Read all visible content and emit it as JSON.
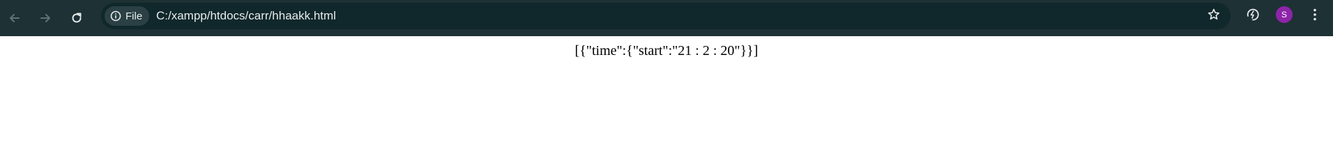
{
  "browser": {
    "back_icon": "arrow-left-icon",
    "forward_icon": "arrow-right-icon",
    "reload_icon": "reload-icon",
    "site_info_icon": "info-icon",
    "site_info_label": "File",
    "url": "C:/xampp/htdocs/carr/hhaakk.html",
    "bookmark_icon": "star-icon",
    "extension_icon": "performance-icon",
    "profile_initial": "S",
    "menu_icon": "kebab-menu-icon",
    "colors": {
      "toolbar_bg": "#1e3135",
      "omnibox_bg": "#10282b",
      "avatar_bg": "#8e24aa"
    }
  },
  "page": {
    "body_text": "[{\"time\":{\"start\":\"21 : 2 : 20\"}}]"
  }
}
